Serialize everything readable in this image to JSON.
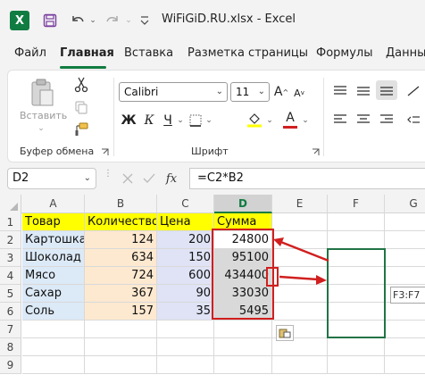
{
  "titlebar": {
    "logo_letter": "X",
    "window_title": "WiFiGiD.RU.xlsx  -  Excel"
  },
  "tabs": [
    {
      "label": "Файл"
    },
    {
      "label": "Главная"
    },
    {
      "label": "Вставка"
    },
    {
      "label": "Разметка страницы"
    },
    {
      "label": "Формулы"
    },
    {
      "label": "Данные"
    }
  ],
  "ribbon": {
    "paste_label": "Вставить",
    "clipboard_group": "Буфер обмена",
    "font_group": "Шрифт",
    "font_name": "Calibri",
    "font_size": "11",
    "bold": "Ж",
    "italic": "К",
    "underline": "Ч",
    "font_color_glyph": "A",
    "grow_glyph": "A",
    "shrink_glyph": "A"
  },
  "formula_bar": {
    "name_box": "D2",
    "fx": "fx",
    "formula": "=C2*B2"
  },
  "grid": {
    "columns": [
      "A",
      "B",
      "C",
      "D",
      "E",
      "F",
      "G"
    ],
    "row_numbers": [
      "1",
      "2",
      "3",
      "4",
      "5",
      "6",
      "7",
      "8",
      "9"
    ],
    "header": [
      "Товар",
      "Количество",
      "Цена",
      "Сумма"
    ],
    "rows": [
      [
        "Картошка",
        "124",
        "200",
        "24800"
      ],
      [
        "Шоколад",
        "634",
        "150",
        "95100"
      ],
      [
        "Мясо",
        "724",
        "600",
        "434400"
      ],
      [
        "Сахар",
        "367",
        "90",
        "33030"
      ],
      [
        "Соль",
        "157",
        "35",
        "5495"
      ]
    ],
    "selection_tooltip": "F3:F7"
  },
  "colors": {
    "accent": "#107c41",
    "annotation_red": "#d11f1f",
    "header_fill": "#ffff00"
  }
}
